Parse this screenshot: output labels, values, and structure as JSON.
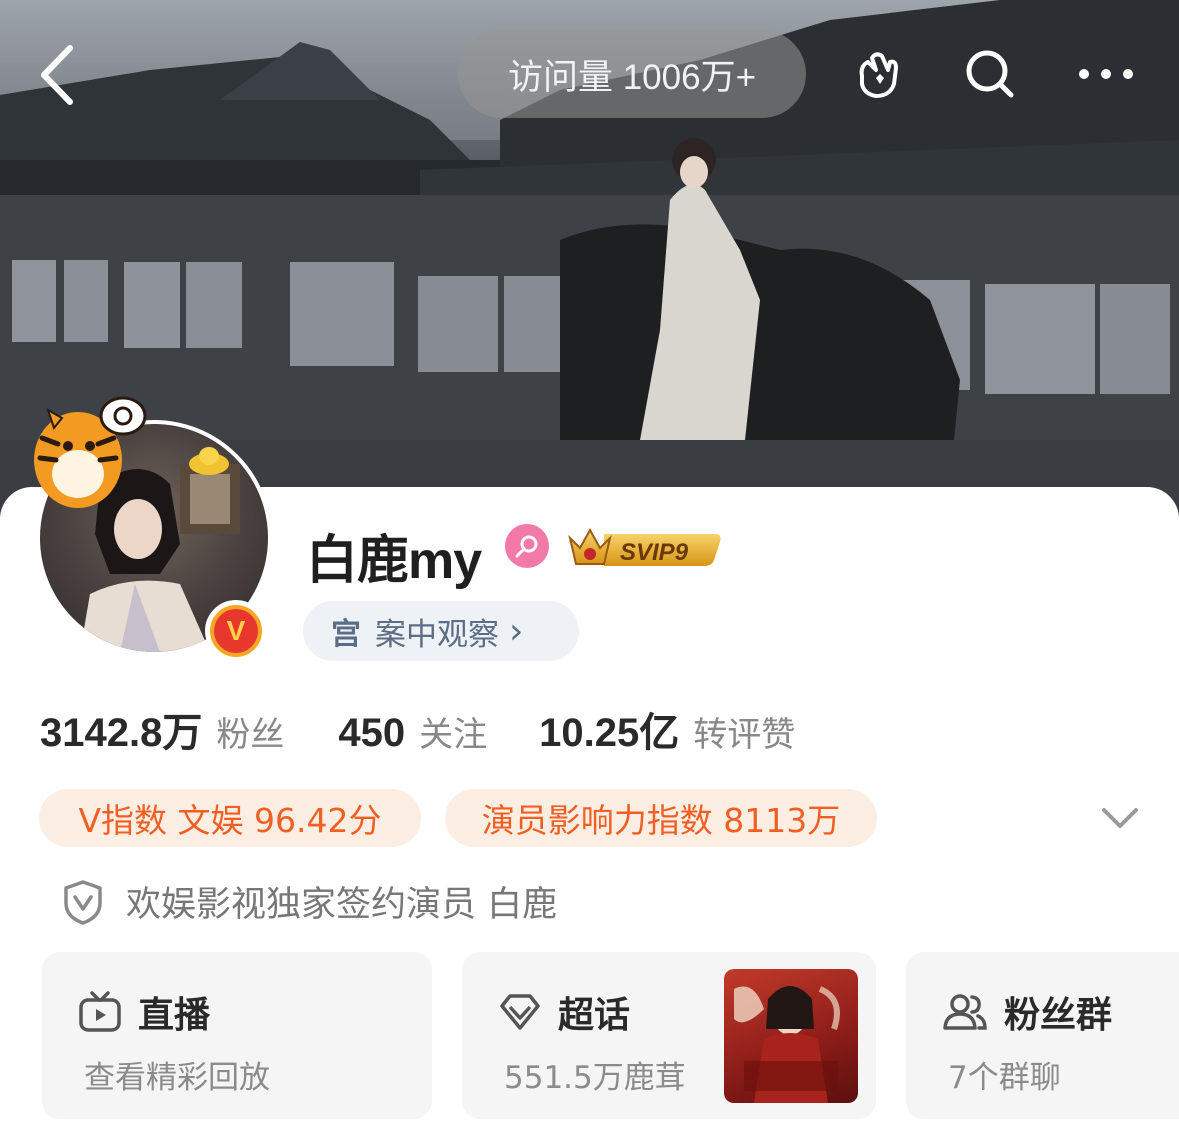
{
  "header": {
    "visits_label": "访问量 1006万+",
    "icons": [
      "back-icon",
      "hand-heart-icon",
      "search-icon",
      "more-icon"
    ]
  },
  "profile": {
    "username": "白鹿my",
    "gender": "female-icon",
    "vip_badge": "SVIP9",
    "verified_badge": "V",
    "tag_icon_char": "宫",
    "tag_label": "案中观察",
    "tag_chevron": "›"
  },
  "stats": [
    {
      "value": "3142.8万",
      "label": "粉丝"
    },
    {
      "value": "450",
      "label": "关注"
    },
    {
      "value": "10.25亿",
      "label": "转评赞"
    }
  ],
  "chips": [
    {
      "label": "V指数 文娱 96.42分"
    },
    {
      "label": "演员影响力指数 8113万"
    }
  ],
  "verification": {
    "text": "欢娱影视独家签约演员 白鹿"
  },
  "tiles": [
    {
      "title": "直播",
      "subtitle": "查看精彩回放",
      "icon": "live-tv-icon"
    },
    {
      "title": "超话",
      "subtitle": "551.5万鹿茸",
      "icon": "diamond-icon"
    },
    {
      "title": "粉丝群",
      "subtitle": "7个群聊",
      "icon": "group-icon"
    }
  ],
  "colors": {
    "accent_orange": "#f25f22",
    "chip_bg": "#fdeee4",
    "tag_blue": "#5b6e86",
    "gender_pink": "#f37aa8",
    "vip_gold": "#e0a21a"
  }
}
